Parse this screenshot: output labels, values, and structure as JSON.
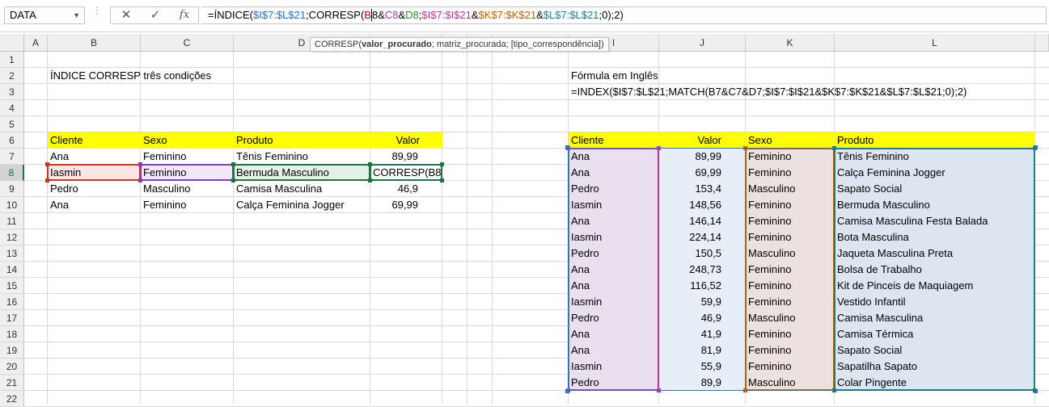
{
  "namebox": "DATA",
  "fx_label": "fx",
  "formula": {
    "p1": "=ÍNDICE(",
    "p2": "$I$7:$L$21",
    "p3": ";CORRESP(",
    "p4": "B",
    "p5": "8",
    "p6": "&",
    "p7": "C8",
    "p8": "&",
    "p9": "D8",
    "p10": ";",
    "p11": "$I$7:$I$21",
    "p12": "&",
    "p13": "$K$7:$K$21",
    "p14": "&",
    "p15": "$L$7:$L$21",
    "p16": ";0);2)"
  },
  "tooltip": {
    "fn": "CORRESP(",
    "arg1": "valor_procurado",
    "rest": "; matriz_procurada; [tipo_correspondência])"
  },
  "columns": [
    "A",
    "B",
    "C",
    "D",
    "E",
    "F",
    "G",
    "H",
    "I",
    "J",
    "K",
    "L"
  ],
  "rows": [
    "1",
    "2",
    "3",
    "4",
    "5",
    "6",
    "7",
    "8",
    "9",
    "10",
    "11",
    "12",
    "13",
    "14",
    "15",
    "16",
    "17",
    "18",
    "19",
    "20",
    "21",
    "22"
  ],
  "left_title": "ÍNDICE CORRESP três condições",
  "right_title": "Fórmula em Inglês",
  "right_formula": "=INDEX($I$7:$L$21;MATCH(B7&C7&D7;$I$7:$I$21&$K$7:$K$21&$L$7:$L$21;0);2)",
  "left_table": {
    "headers": [
      "Cliente",
      "Sexo",
      "Produto",
      "Valor"
    ],
    "rows": [
      [
        "Ana",
        "Feminino",
        "Tênis Feminino",
        "89,99"
      ],
      [
        "Iasmin",
        "Feminino",
        "Bermuda Masculino",
        "CORRESP(B8"
      ],
      [
        "Pedro",
        "Masculino",
        "Camisa Masculina",
        "46,9"
      ],
      [
        "Ana",
        "Feminino",
        "Calça Feminina Jogger",
        "69,99"
      ]
    ]
  },
  "right_table": {
    "headers": [
      "Cliente",
      "Valor",
      "Sexo",
      "Produto"
    ],
    "rows": [
      [
        "Ana",
        "89,99",
        "Feminino",
        "Tênis Feminino"
      ],
      [
        "Ana",
        "69,99",
        "Feminino",
        "Calça Feminina Jogger"
      ],
      [
        "Pedro",
        "153,4",
        "Masculino",
        "Sapato Social"
      ],
      [
        "Iasmin",
        "148,56",
        "Feminino",
        "Bermuda Masculino"
      ],
      [
        "Ana",
        "146,14",
        "Feminino",
        "Camisa Masculina Festa Balada"
      ],
      [
        "Iasmin",
        "224,14",
        "Feminino",
        "Bota Masculina"
      ],
      [
        "Pedro",
        "150,5",
        "Masculino",
        "Jaqueta Masculina Preta"
      ],
      [
        "Ana",
        "248,73",
        "Feminino",
        "Bolsa de Trabalho"
      ],
      [
        "Ana",
        "116,52",
        "Feminino",
        "Kit de Pinceis de Maquiagem"
      ],
      [
        "Iasmin",
        "59,9",
        "Feminino",
        "Vestido Infantil"
      ],
      [
        "Pedro",
        "46,9",
        "Masculino",
        "Camisa Masculina"
      ],
      [
        "Ana",
        "41,9",
        "Feminino",
        "Camisa Térmica"
      ],
      [
        "Ana",
        "81,9",
        "Feminino",
        "Sapato Social"
      ],
      [
        "Iasmin",
        "55,9",
        "Feminino",
        "Sapatilha Sapato"
      ],
      [
        "Pedro",
        "89,9",
        "Masculino",
        "Colar Pingente"
      ]
    ]
  },
  "colors": {
    "header_fill": "#ffff00",
    "ref_b8": "#c0392b",
    "ref_c8": "#7e3fbf",
    "ref_d8": "#217346",
    "ref_i": "#b83b9a",
    "ref_k": "#c06000",
    "ref_l": "#1f7a8c"
  }
}
